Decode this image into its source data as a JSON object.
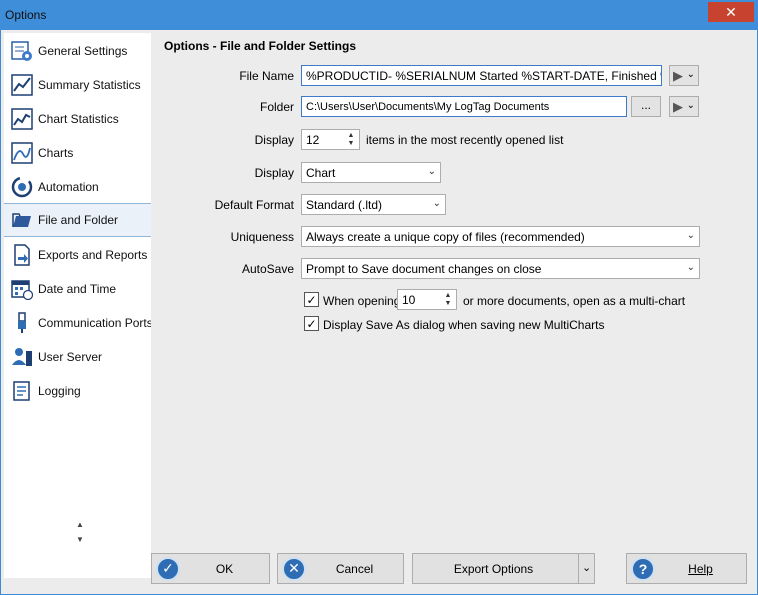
{
  "window": {
    "title": "Options",
    "close_glyph": "✕"
  },
  "sidebar": {
    "items": [
      {
        "label": "General Settings",
        "icon": "general-settings-icon"
      },
      {
        "label": "Summary Statistics",
        "icon": "summary-statistics-icon"
      },
      {
        "label": "Chart Statistics",
        "icon": "chart-statistics-icon"
      },
      {
        "label": "Charts",
        "icon": "charts-icon"
      },
      {
        "label": "Automation",
        "icon": "automation-icon"
      },
      {
        "label": "File and Folder",
        "icon": "folder-icon"
      },
      {
        "label": "Exports and Reports",
        "icon": "exports-icon"
      },
      {
        "label": "Date and Time",
        "icon": "calendar-icon"
      },
      {
        "label": "Communication Ports",
        "icon": "usb-icon"
      },
      {
        "label": "User Server",
        "icon": "server-icon"
      },
      {
        "label": "Logging",
        "icon": "logging-icon"
      }
    ],
    "selected_index": 5,
    "scroll_up": "▲",
    "scroll_down": "▼"
  },
  "main": {
    "heading": "Options - File and Folder Settings",
    "file_name": {
      "label": "File Name",
      "value": "%PRODUCTID- %SERIALNUM Started %START-DATE, Finished %FINISH"
    },
    "folder": {
      "label": "Folder",
      "value": "C:\\Users\\User\\Documents\\My LogTag Documents",
      "browse_label": "..."
    },
    "recent": {
      "label": "Display",
      "value": "12",
      "suffix": "items in the most recently opened list"
    },
    "display": {
      "label": "Display",
      "value": "Chart"
    },
    "default_format": {
      "label": "Default Format",
      "value": "Standard (.ltd)"
    },
    "uniqueness": {
      "label": "Uniqueness",
      "value": "Always create a unique copy of files (recommended)"
    },
    "autosave": {
      "label": "AutoSave",
      "value": "Prompt to Save document changes on close"
    },
    "multi_chart": {
      "checked": true,
      "prefix": "When opening",
      "value": "10",
      "suffix": "or more documents, open as a multi-chart"
    },
    "save_as_dialog": {
      "checked": true,
      "label": "Display Save As dialog when saving new MultiCharts"
    },
    "check_glyph": "✓",
    "play_glyph": "▶",
    "dropdown_glyph": "⌄",
    "spin_up": "▲",
    "spin_down": "▼"
  },
  "footer": {
    "ok_label": "OK",
    "cancel_label": "Cancel",
    "export_label": "Export Options",
    "help_label": "Help",
    "ok_glyph": "✓",
    "cancel_glyph": "✕",
    "help_glyph": "?"
  },
  "colors": {
    "accent": "#3f8ed9",
    "close": "#c7432f",
    "icon_blue": "#2e6db4"
  }
}
